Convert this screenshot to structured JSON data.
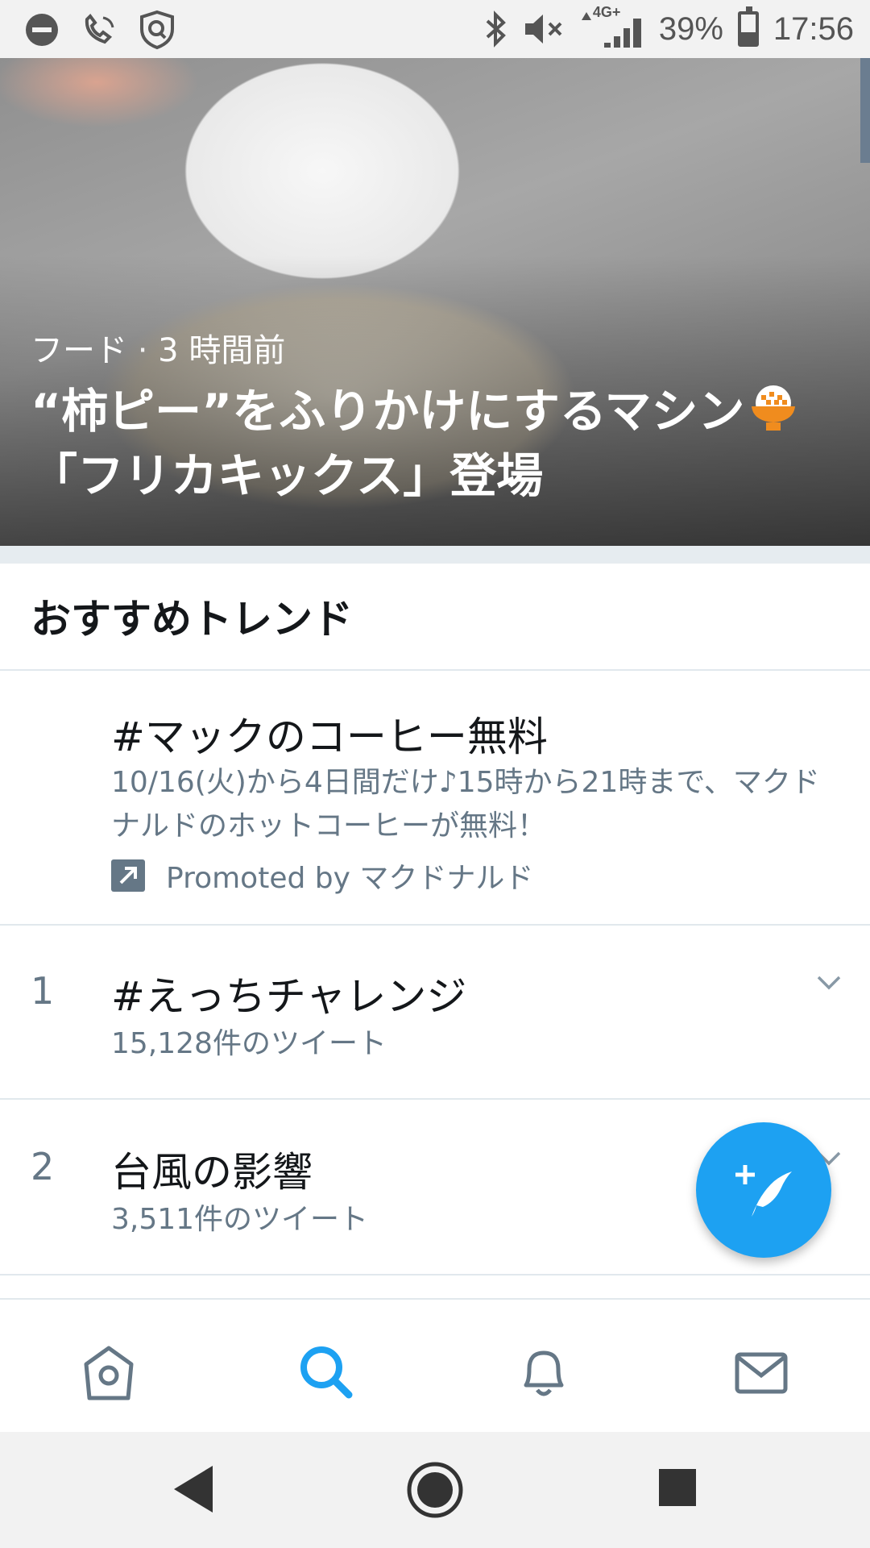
{
  "status_bar": {
    "network": "4G+",
    "battery": "39%",
    "time": "17:56"
  },
  "hero": {
    "category": "フード",
    "separator": "·",
    "time_ago": "3 時間前",
    "title_part1": "“柿ピー”をふりかけにするマシン",
    "title_part2": "「フリカキックス」登場"
  },
  "section": {
    "title": "おすすめトレンド"
  },
  "promoted_trend": {
    "title": "#マックのコーヒー無料",
    "description": "10/16(火)から4日間だけ♪15時から21時まで、マクドナルドのホットコーヒーが無料！",
    "promoted_label": "Promoted by マクドナルド"
  },
  "trends": [
    {
      "rank": "1",
      "title": "#えっちチャレンジ",
      "count": "15,128件のツイート"
    },
    {
      "rank": "2",
      "title": "台風の影響",
      "count": "3,511件のツイート"
    }
  ],
  "colors": {
    "accent": "#1da1f2",
    "secondary_text": "#657786",
    "icon_gray": "#657786"
  },
  "icons": {
    "fab": "compose-tweet-icon",
    "nav": [
      "home-icon",
      "search-icon",
      "bell-icon",
      "mail-icon"
    ],
    "android": [
      "back-icon",
      "home-circle-icon",
      "recents-icon"
    ]
  }
}
